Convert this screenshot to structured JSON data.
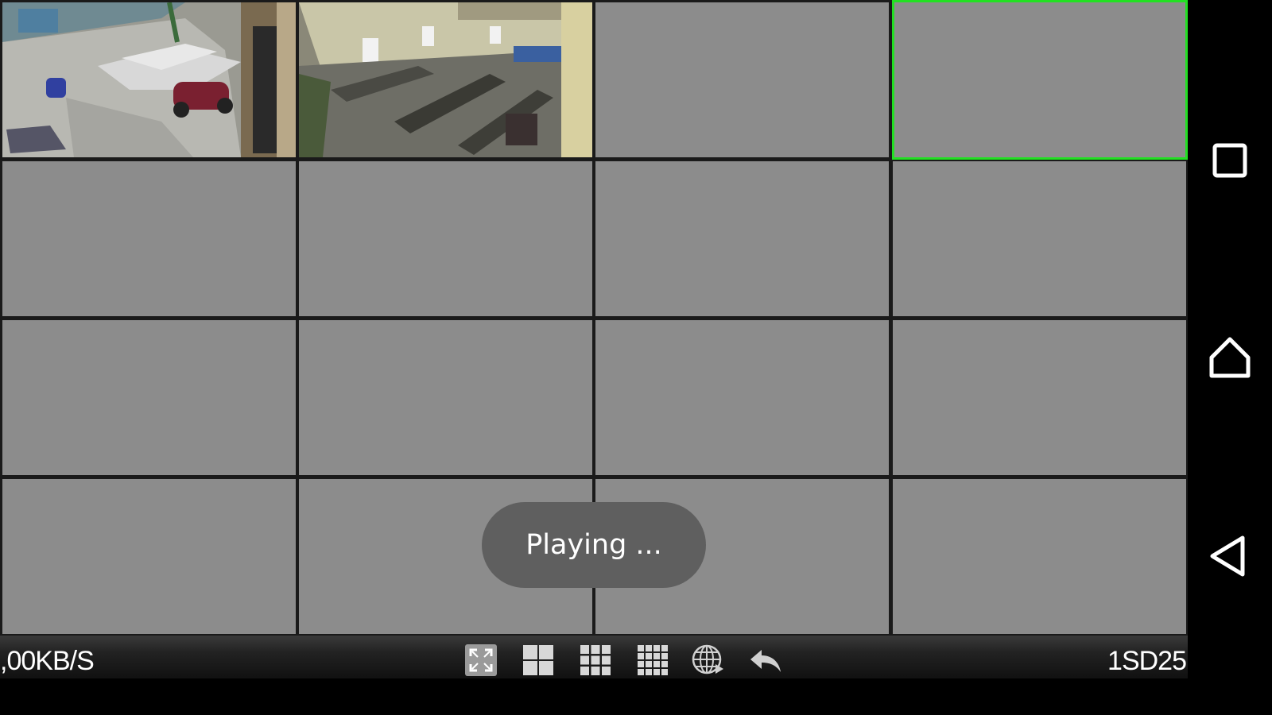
{
  "toolbar": {
    "speed_text": ",00KB/S",
    "device_text": "1SD25",
    "buttons": [
      {
        "icon": "fullscreen-icon"
      },
      {
        "icon": "grid-2x2-icon"
      },
      {
        "icon": "grid-3x3-icon"
      },
      {
        "icon": "grid-4x4-icon"
      },
      {
        "icon": "globe-icon"
      },
      {
        "icon": "back-arrow-icon"
      }
    ]
  },
  "toast": {
    "text": "Playing ..."
  },
  "grid": {
    "layout": "4x4",
    "selected_channel": 4,
    "channels": [
      {
        "channel": 1,
        "state": "live"
      },
      {
        "channel": 2,
        "state": "live"
      },
      {
        "channel": 3,
        "state": "empty"
      },
      {
        "channel": 4,
        "state": "empty"
      },
      {
        "channel": 5,
        "state": "empty"
      },
      {
        "channel": 6,
        "state": "empty"
      },
      {
        "channel": 7,
        "state": "empty"
      },
      {
        "channel": 8,
        "state": "empty"
      },
      {
        "channel": 9,
        "state": "empty"
      },
      {
        "channel": 10,
        "state": "empty"
      },
      {
        "channel": 11,
        "state": "empty"
      },
      {
        "channel": 12,
        "state": "empty"
      },
      {
        "channel": 13,
        "state": "empty"
      },
      {
        "channel": 14,
        "state": "empty"
      },
      {
        "channel": 15,
        "state": "empty"
      },
      {
        "channel": 16,
        "state": "empty"
      }
    ]
  },
  "navbar": {
    "buttons": [
      {
        "icon": "recent-apps-icon"
      },
      {
        "icon": "home-icon"
      },
      {
        "icon": "back-icon"
      }
    ]
  },
  "colors": {
    "tile_bg": "#8c8c8c",
    "selected_border": "#22e022",
    "toast_bg": "#5f5f5f"
  }
}
